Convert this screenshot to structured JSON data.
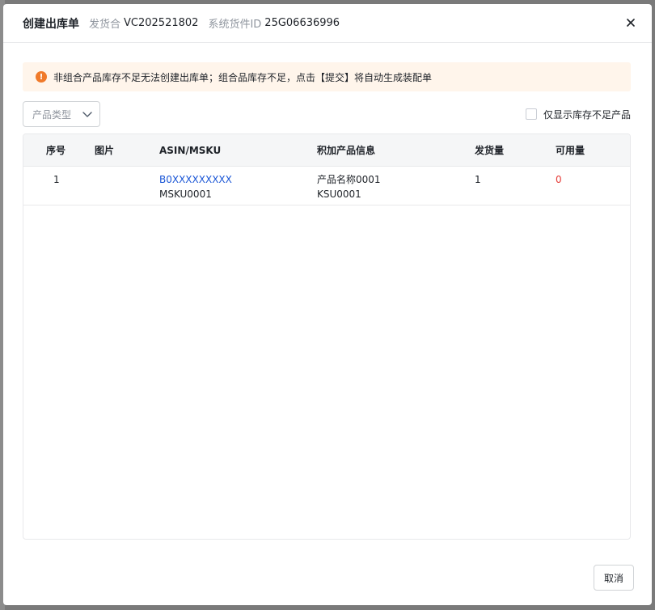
{
  "modal": {
    "title": "创建出库单",
    "shipment_label": "发货合",
    "shipment_value": "VC202521802",
    "system_id_label": "系统货件ID",
    "system_id_value": "25G06636996"
  },
  "alert": {
    "icon": "exclamation-icon",
    "icon_glyph": "!",
    "text": "非组合产品库存不足无法创建出库单；组合品库存不足，点击【提交】将自动生成装配单",
    "color": "#f07a2a"
  },
  "filters": {
    "product_type_placeholder": "产品类型",
    "only_shortage_label": "仅显示库存不足产品"
  },
  "table": {
    "columns": [
      "序号",
      "图片",
      "ASIN/MSKU",
      "积加产品信息",
      "发货量",
      "可用量"
    ],
    "rows": [
      {
        "index": "1",
        "asin": "B0XXXXXXXXX",
        "msku": "MSKU0001",
        "product_name": "产品名称0001",
        "sku": "KSU0001",
        "ship_qty": "1",
        "available_qty": "0"
      }
    ]
  },
  "footer": {
    "cancel_label": "取消"
  },
  "colors": {
    "link": "#1a56d6",
    "danger": "#e53935",
    "alert_bg": "#fff5eb"
  }
}
